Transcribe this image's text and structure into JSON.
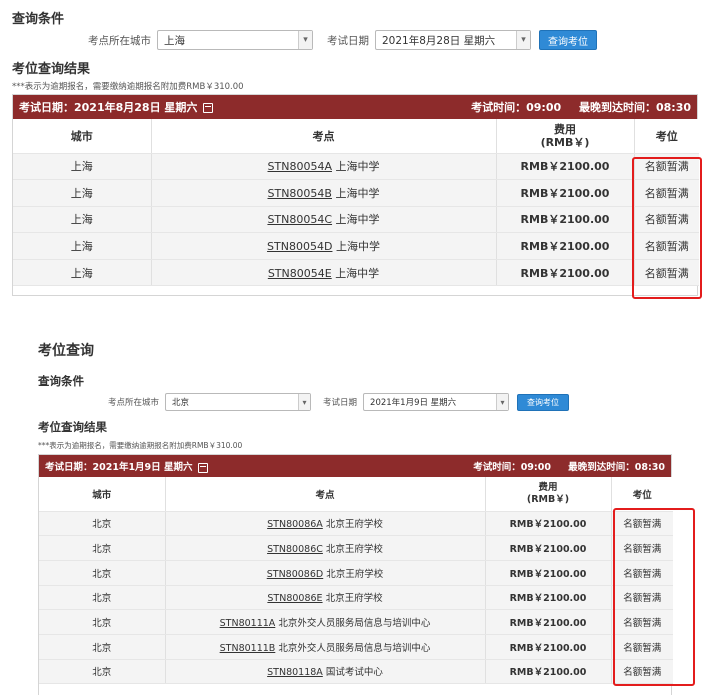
{
  "panel1": {
    "section_title": "查询条件",
    "city_label": "考点所在城市",
    "city_value": "上海",
    "date_label": "考试日期",
    "date_value": "2021年8月28日 星期六",
    "query_button": "查询考位",
    "results_title": "考位查询结果",
    "note": "***表示为逾期报名，需要缴纳逾期报名附加费RMB￥310.00",
    "bar_date": "考试日期：2021年8月28日 星期六",
    "bar_exam_time": "考试时间：09:00",
    "bar_latest_arrival": "最晚到达时间：08:30",
    "headers": {
      "city": "城市",
      "site": "考点",
      "fee": "费用\n(RMB￥)",
      "seat": "考位"
    },
    "rows": [
      {
        "city": "上海",
        "code": "STN80054A",
        "name": "上海中学",
        "fee": "RMB￥2100.00",
        "seat": "名额暂满"
      },
      {
        "city": "上海",
        "code": "STN80054B",
        "name": "上海中学",
        "fee": "RMB￥2100.00",
        "seat": "名额暂满"
      },
      {
        "city": "上海",
        "code": "STN80054C",
        "name": "上海中学",
        "fee": "RMB￥2100.00",
        "seat": "名额暂满"
      },
      {
        "city": "上海",
        "code": "STN80054D",
        "name": "上海中学",
        "fee": "RMB￥2100.00",
        "seat": "名额暂满"
      },
      {
        "city": "上海",
        "code": "STN80054E",
        "name": "上海中学",
        "fee": "RMB￥2100.00",
        "seat": "名额暂满"
      }
    ]
  },
  "panel2": {
    "page_title": "考位查询",
    "section_title": "查询条件",
    "city_label": "考点所在城市",
    "city_value": "北京",
    "date_label": "考试日期",
    "date_value": "2021年1月9日 星期六",
    "query_button": "查询考位",
    "results_title": "考位查询结果",
    "note": "***表示为逾期报名，需要缴纳逾期报名附加费RMB￥310.00",
    "bar_date": "考试日期：2021年1月9日 星期六",
    "bar_exam_time": "考试时间：09:00",
    "bar_latest_arrival": "最晚到达时间：08:30",
    "headers": {
      "city": "城市",
      "site": "考点",
      "fee": "费用\n(RMB￥)",
      "seat": "考位"
    },
    "rows": [
      {
        "city": "北京",
        "code": "STN80086A",
        "name": "北京王府学校",
        "fee": "RMB￥2100.00",
        "seat": "名额暂满"
      },
      {
        "city": "北京",
        "code": "STN80086C",
        "name": "北京王府学校",
        "fee": "RMB￥2100.00",
        "seat": "名额暂满"
      },
      {
        "city": "北京",
        "code": "STN80086D",
        "name": "北京王府学校",
        "fee": "RMB￥2100.00",
        "seat": "名额暂满"
      },
      {
        "city": "北京",
        "code": "STN80086E",
        "name": "北京王府学校",
        "fee": "RMB￥2100.00",
        "seat": "名额暂满"
      },
      {
        "city": "北京",
        "code": "STN80111A",
        "name": "北京外交人员服务局信息与培训中心",
        "fee": "RMB￥2100.00",
        "seat": "名额暂满"
      },
      {
        "city": "北京",
        "code": "STN80111B",
        "name": "北京外交人员服务局信息与培训中心",
        "fee": "RMB￥2100.00",
        "seat": "名额暂满"
      },
      {
        "city": "北京",
        "code": "STN80118A",
        "name": "国试考试中心",
        "fee": "RMB￥2100.00",
        "seat": "名额暂满"
      }
    ]
  },
  "colors": {
    "bar": "#8d2b2b",
    "button": "#2f8ad6",
    "highlight": "#e31c1c"
  }
}
